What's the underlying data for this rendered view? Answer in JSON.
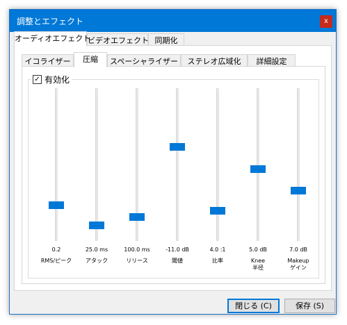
{
  "window": {
    "title": "調整とエフェクト",
    "close_glyph": "x"
  },
  "main_tabs": [
    "オーディオエフェクト",
    "ビデオエフェクト",
    "同期化"
  ],
  "sub_tabs": [
    "イコライザー",
    "圧縮",
    "スペーシャライザー",
    "ステレオ広域化",
    "詳細設定"
  ],
  "enable": {
    "label": "有効化",
    "checked": true,
    "check_glyph": "✓"
  },
  "sliders": [
    {
      "value": "0.2",
      "label": "RMS/ピーク",
      "level": 0.22
    },
    {
      "value": "25.0 ms",
      "label": "アタック",
      "level": 0.08
    },
    {
      "value": "100.0 ms",
      "label": "リリース",
      "level": 0.14
    },
    {
      "value": "-11.0 dB",
      "label": "閾値",
      "level": 0.62
    },
    {
      "value": "4.0 :1",
      "label": "比率",
      "level": 0.18
    },
    {
      "value": "5.0 dB",
      "label": "Knee\n半径",
      "level": 0.47
    },
    {
      "value": "7.0 dB",
      "label": "Makeup\nゲイン",
      "level": 0.32
    }
  ],
  "buttons": {
    "close": "閉じる (C)",
    "save": "保存 (S)"
  },
  "colors": {
    "accent": "#0078d7",
    "titlebar": "#0078d7",
    "close": "#c42b1c"
  }
}
